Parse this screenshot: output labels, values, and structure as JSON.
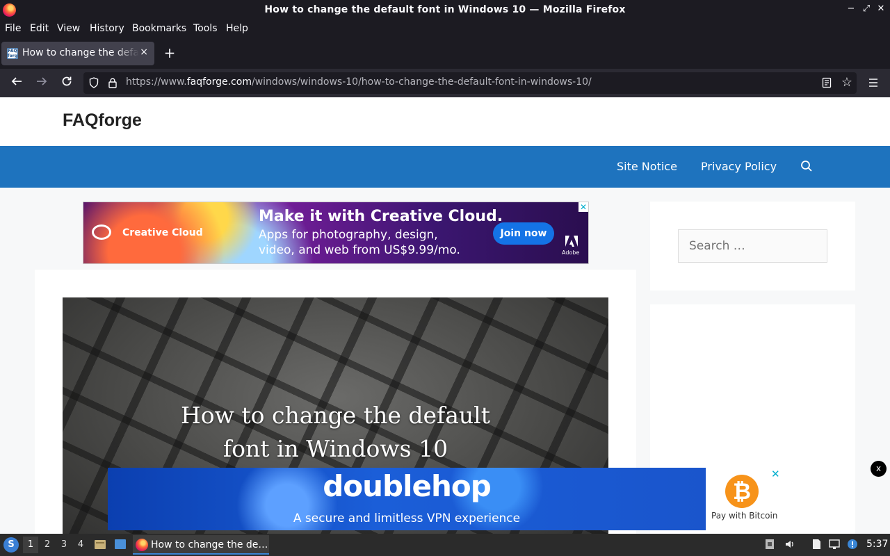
{
  "window": {
    "title": "How to change the default font in Windows 10 — Mozilla Firefox",
    "controls": {
      "minimize": "−",
      "maximize": "⤢",
      "close": "✕"
    }
  },
  "menubar": [
    "File",
    "Edit",
    "View",
    "History",
    "Bookmarks",
    "Tools",
    "Help"
  ],
  "tabs": [
    {
      "title": "How to change the default font in Windows 10",
      "favicon_text": "FAQ forge",
      "close": "×",
      "active": true
    }
  ],
  "new_tab_label": "+",
  "navigation": {
    "url_prefix": "https://www.",
    "url_domain": "faqforge.com",
    "url_path": "/windows/windows-10/how-to-change-the-default-font-in-windows-10/"
  },
  "site": {
    "title": "FAQforge",
    "nav_links": [
      "Site Notice",
      "Privacy Policy"
    ],
    "search_placeholder": "Search …",
    "colors": {
      "nav": "#1e73be",
      "background": "#f7f8f9"
    }
  },
  "top_ad": {
    "brand": "Creative Cloud",
    "headline": "Make it with Creative Cloud.",
    "subline": "Apps for photography, design, video, and web from US$9.99/mo.",
    "button": "Join now",
    "vendor": "Adobe",
    "adchoices": "✕"
  },
  "article": {
    "hero_title_line1": "How to change the default",
    "hero_title_line2": "font in Windows 10"
  },
  "bottom_ad": {
    "brand": "doublehop",
    "tagline": "A secure and limitless VPN experience",
    "side_text": "Pay with Bitcoin",
    "side_symbol": "₿",
    "close": "✕",
    "floating_close": "x"
  },
  "taskbar": {
    "start_label": "S",
    "workspaces": [
      "1",
      "2",
      "3",
      "4"
    ],
    "active_workspace": "1",
    "task_label": "How to change the de…",
    "clock": "5:37"
  }
}
